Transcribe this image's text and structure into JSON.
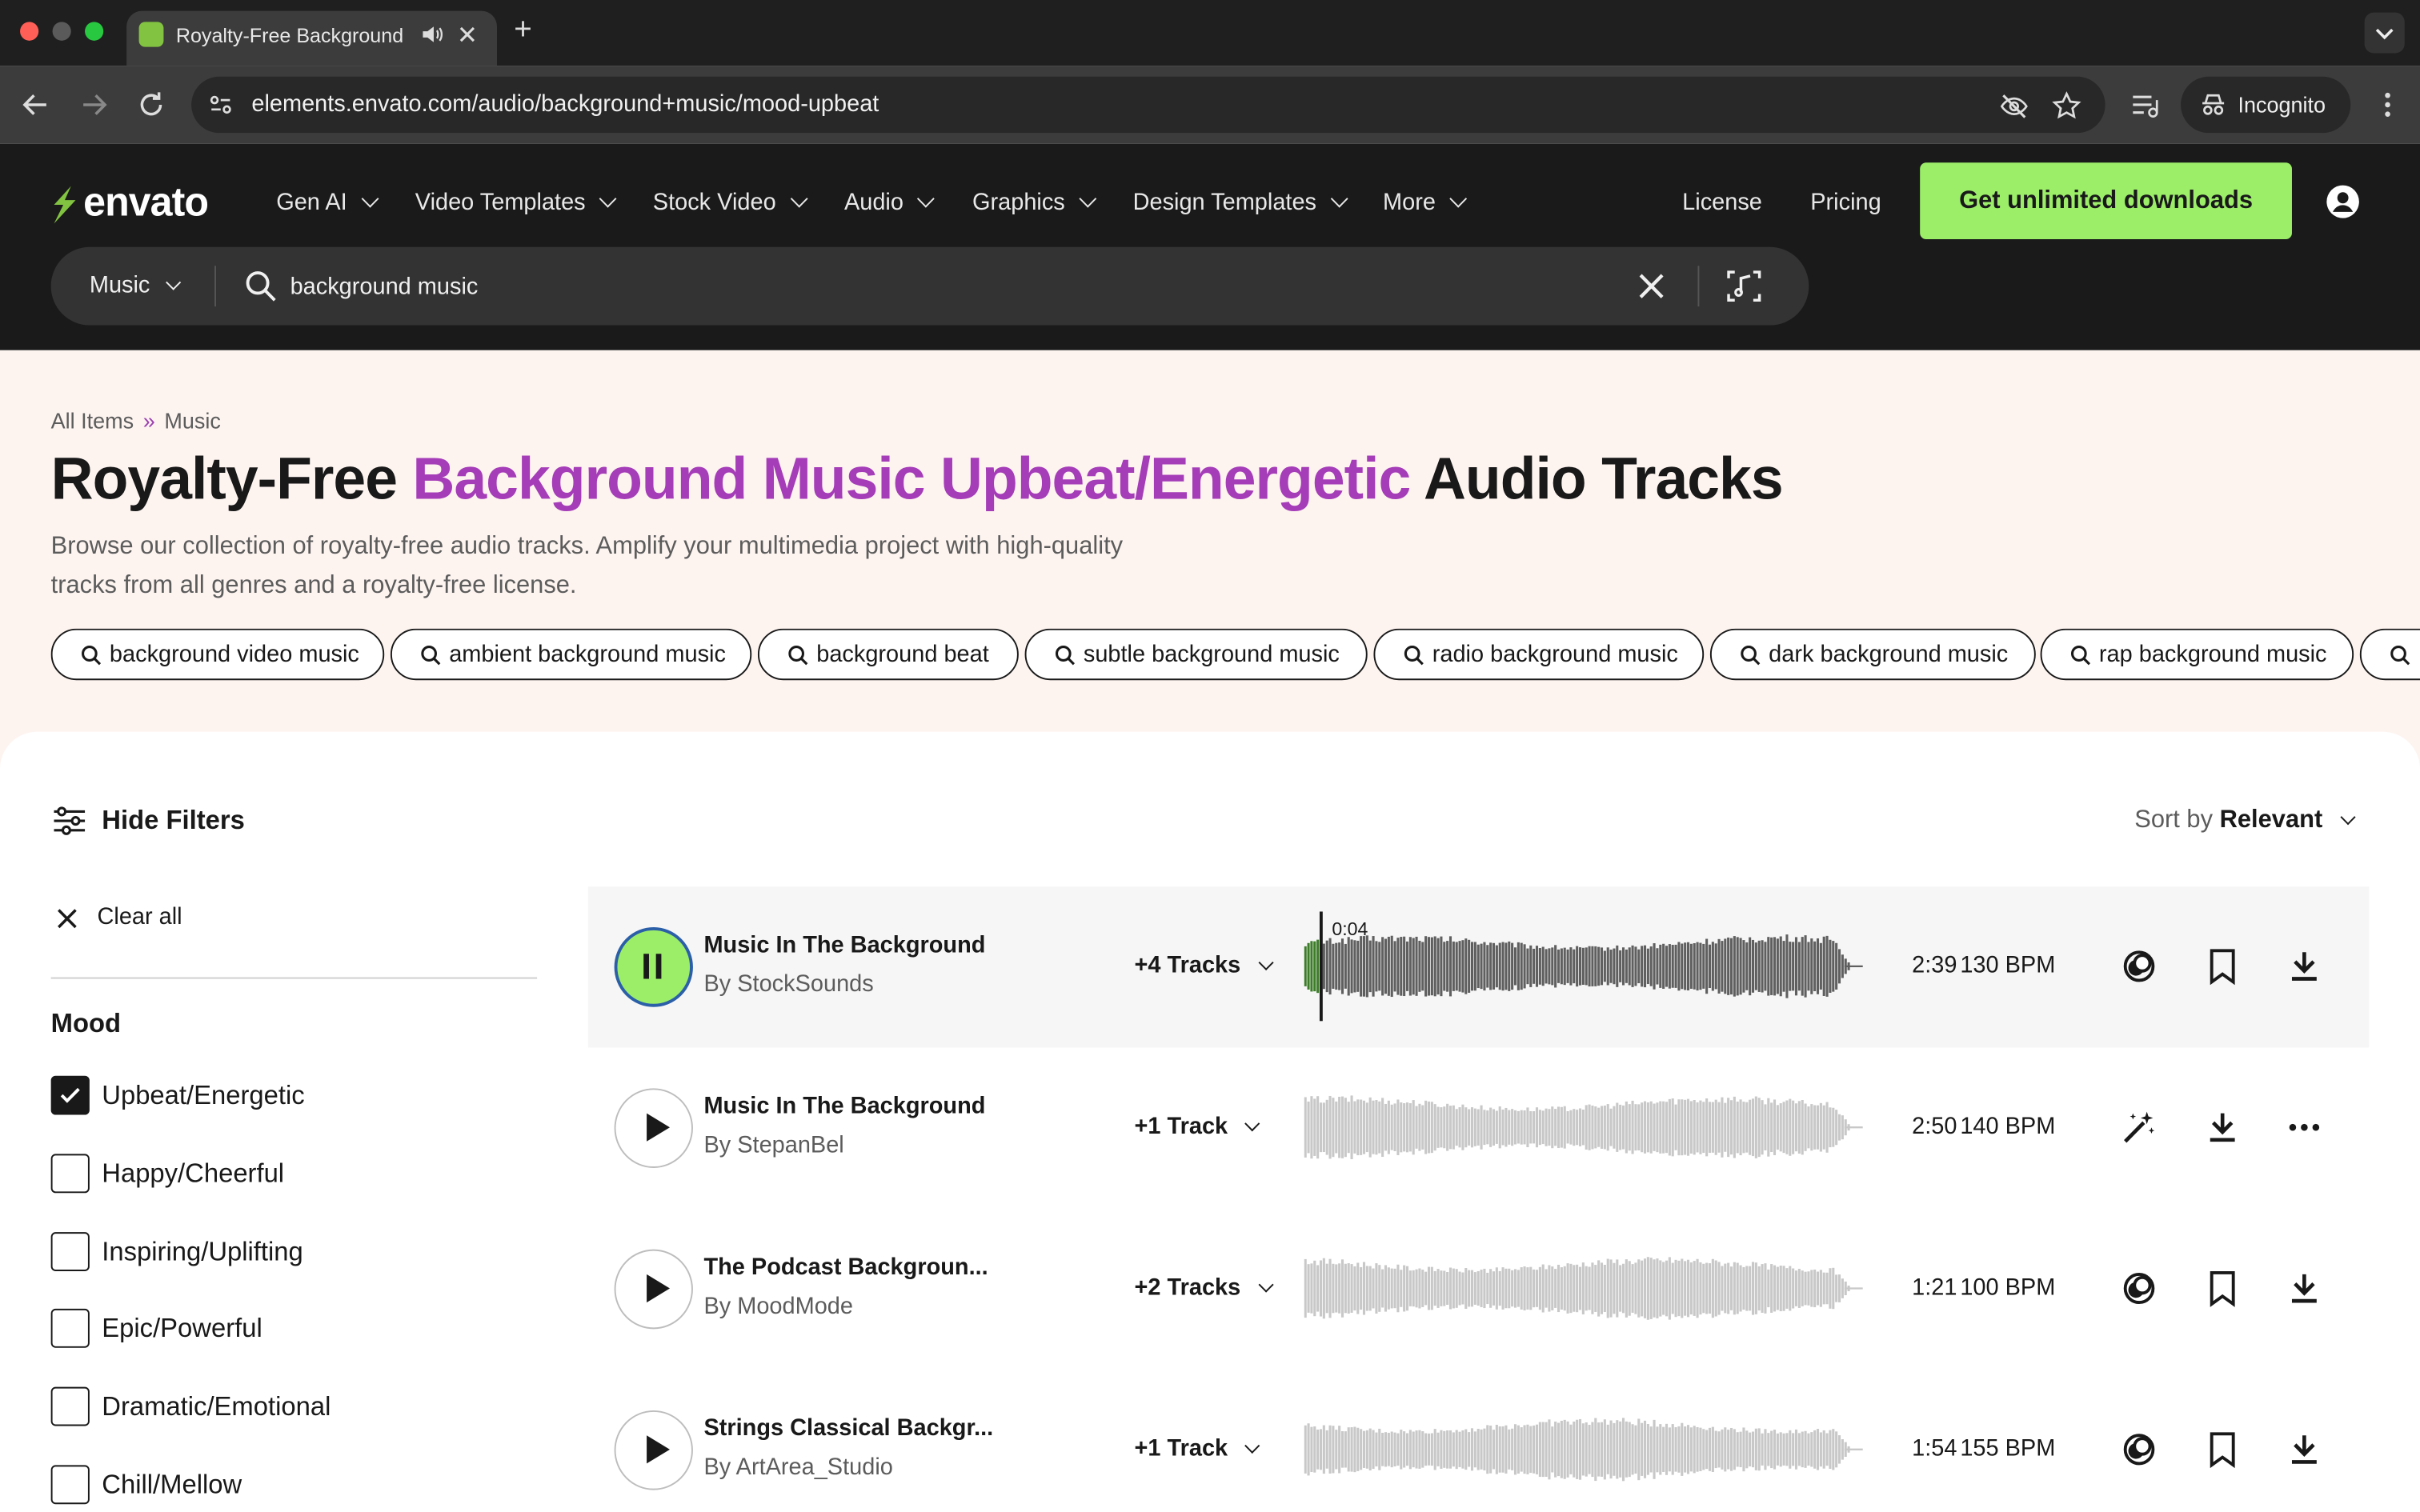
{
  "browser": {
    "tab_title": "Royalty-Free Background",
    "url": "elements.envato.com/audio/background+music/mood-upbeat",
    "incognito_label": "Incognito"
  },
  "header": {
    "logo_text": "envato",
    "nav": [
      {
        "label": "Gen AI",
        "icon": "chevron-down-icon"
      },
      {
        "label": "Video Templates",
        "icon": "chevron-down-icon"
      },
      {
        "label": "Stock Video",
        "icon": "chevron-down-icon"
      },
      {
        "label": "Audio",
        "icon": "chevron-down-icon"
      },
      {
        "label": "Graphics",
        "icon": "chevron-down-icon"
      },
      {
        "label": "Design Templates",
        "icon": "chevron-down-icon"
      },
      {
        "label": "More",
        "icon": "chevron-down-icon"
      }
    ],
    "license": "License",
    "pricing": "Pricing",
    "cta": "Get unlimited downloads",
    "search_category": "Music",
    "search_value": "background music"
  },
  "hero": {
    "breadcrumb": [
      "All Items",
      "»",
      "Music"
    ],
    "title_start": "Royalty-Free ",
    "title_highlight": "Background Music Upbeat/Energetic",
    "title_end": " Audio Tracks",
    "description": "Browse our collection of royalty-free audio tracks. Amplify your multimedia project with high-quality tracks from all genres and a royalty-free license.",
    "chips": [
      "background video music",
      "ambient background music",
      "background beat",
      "subtle background music",
      "radio background music",
      "dark background music",
      "rap background music"
    ]
  },
  "filters": {
    "hide_label": "Hide Filters",
    "clear_label": "Clear all",
    "mood_heading": "Mood",
    "moods": [
      {
        "label": "Upbeat/Energetic",
        "checked": true
      },
      {
        "label": "Happy/Cheerful",
        "checked": false
      },
      {
        "label": "Inspiring/Uplifting",
        "checked": false
      },
      {
        "label": "Epic/Powerful",
        "checked": false
      },
      {
        "label": "Dramatic/Emotional",
        "checked": false
      },
      {
        "label": "Chill/Mellow",
        "checked": false
      }
    ]
  },
  "sort": {
    "prefix": "Sort by",
    "value": "Relevant"
  },
  "tracks": [
    {
      "name": "Music In The Background",
      "author": "By StockSounds",
      "tracks": "+4 Tracks",
      "duration": "2:39",
      "bpm": "130 BPM",
      "playing": true,
      "elapsed": "0:04",
      "progress": 0.026,
      "actions": [
        "similar-icon",
        "bookmark-icon",
        "download-icon"
      ]
    },
    {
      "name": "Music In The Background",
      "author": "By StepanBel",
      "tracks": "+1 Track",
      "duration": "2:50",
      "bpm": "140 BPM",
      "playing": false,
      "actions": [
        "magic-wand-icon",
        "download-icon",
        "more-icon"
      ]
    },
    {
      "name": "The Podcast Backgroun...",
      "author": "By MoodMode",
      "tracks": "+2 Tracks",
      "duration": "1:21",
      "bpm": "100 BPM",
      "playing": false,
      "actions": [
        "similar-icon",
        "bookmark-icon",
        "download-icon"
      ]
    },
    {
      "name": "Strings Classical Backgr...",
      "author": "By ArtArea_Studio",
      "tracks": "+1 Track",
      "duration": "1:54",
      "bpm": "155 BPM",
      "playing": false,
      "actions": [
        "similar-icon",
        "bookmark-icon",
        "download-icon"
      ]
    }
  ],
  "colors": {
    "accent_green": "#9cee69",
    "highlight_purple": "#a53cb8",
    "header_bg": "#1a1a1a",
    "hero_bg": "#fdf4f0",
    "wave_active": "#5f5f5f",
    "wave_inactive": "#c8c8c8"
  }
}
